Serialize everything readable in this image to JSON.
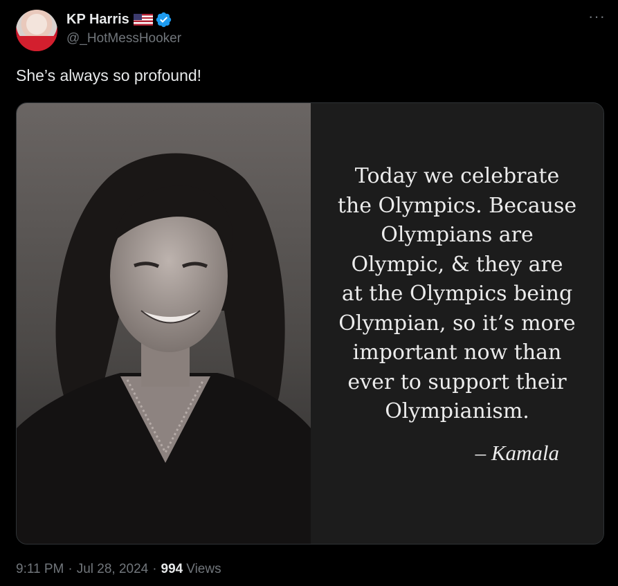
{
  "author": {
    "display_name": "KP Harris",
    "handle": "@_HotMessHooker",
    "flag_emoji": "us-flag",
    "verified_color": "#1d9bf0"
  },
  "menu": {
    "more_label": "···"
  },
  "tweet": {
    "text": "She’s always so profound!"
  },
  "media": {
    "quote": "Today we celebrate\nthe Olympics. Because\nOlympians are\nOlympic, & they are\nat the Olympics being\nOlympian, so it’s more\nimportant now than\never to support their\nOlympianism.",
    "attribution": "– Kamala"
  },
  "meta": {
    "time": "9:11 PM",
    "separator": "·",
    "date": "Jul 28, 2024",
    "views_count": "994",
    "views_label": "Views"
  }
}
